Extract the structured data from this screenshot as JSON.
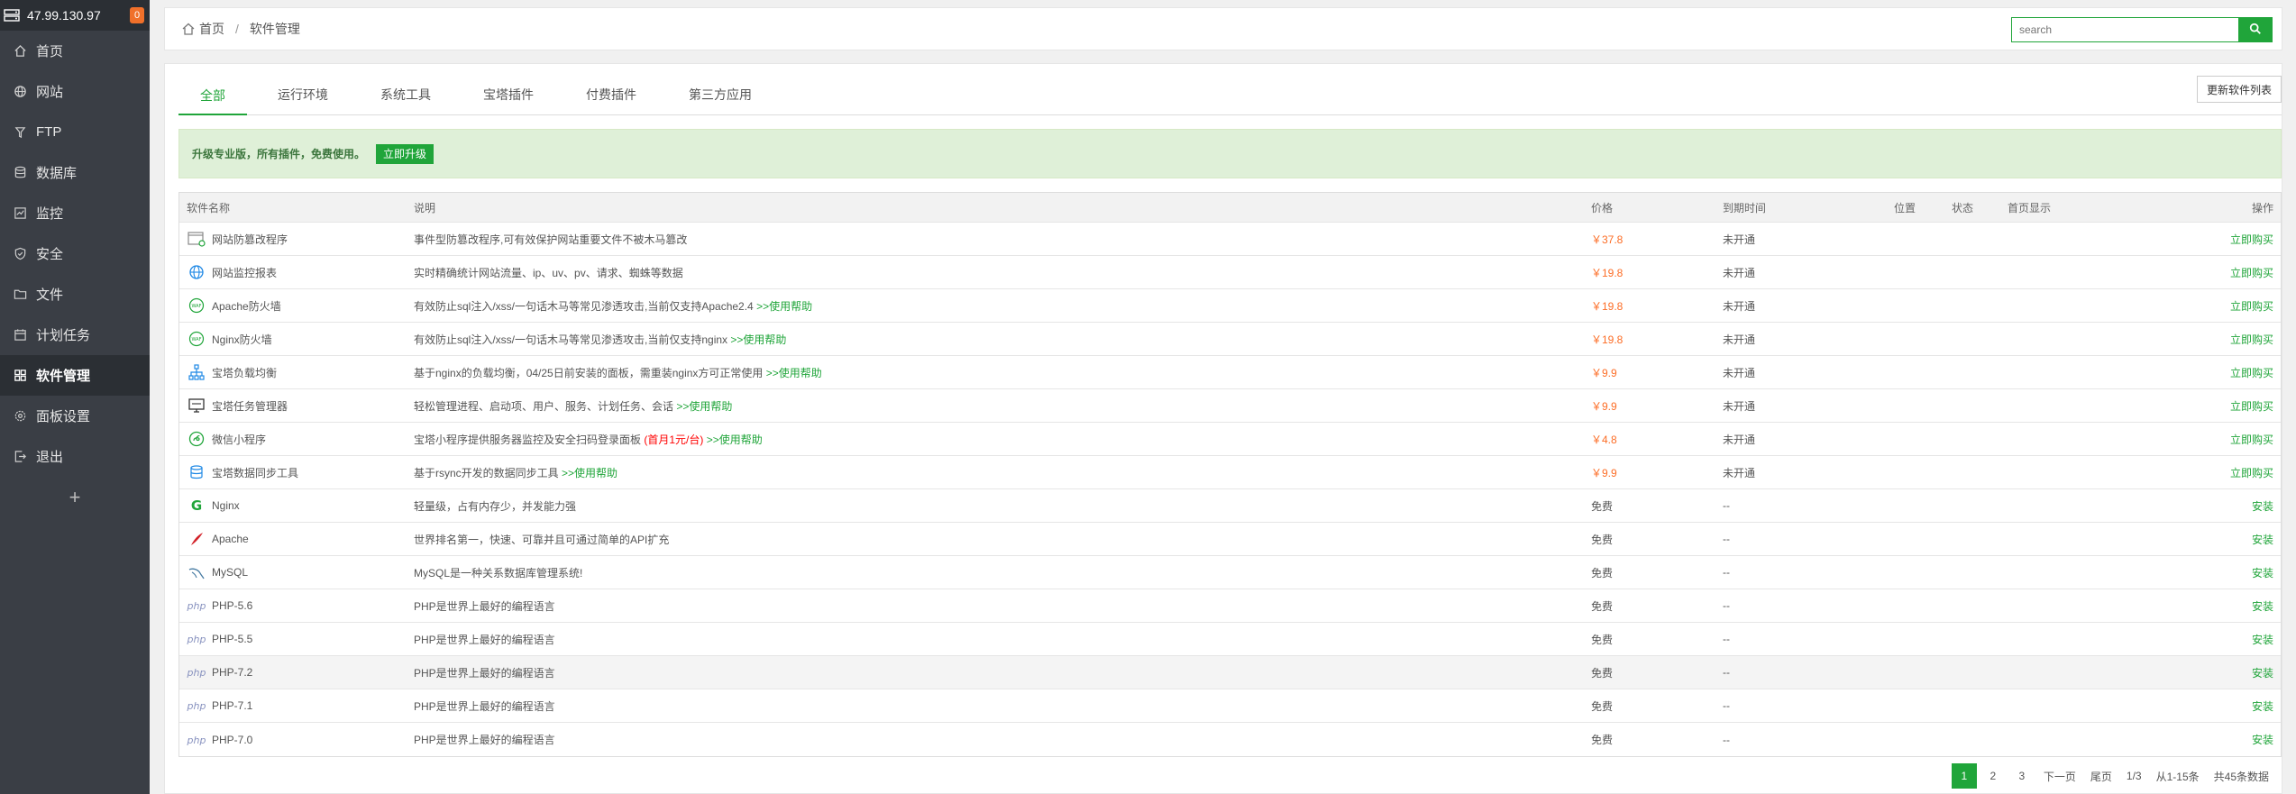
{
  "sidebar": {
    "ip": "47.99.130.97",
    "badge": "0",
    "items": [
      {
        "label": "首页",
        "icon": "home-icon"
      },
      {
        "label": "网站",
        "icon": "globe-icon"
      },
      {
        "label": "FTP",
        "icon": "ftp-icon"
      },
      {
        "label": "数据库",
        "icon": "database-icon"
      },
      {
        "label": "监控",
        "icon": "monitor-icon"
      },
      {
        "label": "安全",
        "icon": "shield-icon"
      },
      {
        "label": "文件",
        "icon": "folder-icon"
      },
      {
        "label": "计划任务",
        "icon": "calendar-icon"
      },
      {
        "label": "软件管理",
        "icon": "grid-icon"
      },
      {
        "label": "面板设置",
        "icon": "gear-icon"
      },
      {
        "label": "退出",
        "icon": "logout-icon"
      }
    ],
    "add_label": "+"
  },
  "breadcrumb": {
    "home": "首页",
    "sep": "/",
    "current": "软件管理"
  },
  "search": {
    "placeholder": "search"
  },
  "tabs": [
    "全部",
    "运行环境",
    "系统工具",
    "宝塔插件",
    "付费插件",
    "第三方应用"
  ],
  "update_button": "更新软件列表",
  "alert": {
    "text": "升级专业版，所有插件，免费使用。",
    "button": "立即升级"
  },
  "table": {
    "headers": {
      "name": "软件名称",
      "desc": "说明",
      "price": "价格",
      "expire": "到期时间",
      "location": "位置",
      "status": "状态",
      "home": "首页显示",
      "op": "操作"
    },
    "rows": [
      {
        "name": "网站防篡改程序",
        "icon": "tamper-icon",
        "desc": "事件型防篡改程序,可有效保护网站重要文件不被木马篡改",
        "help": "",
        "price": "￥37.8",
        "expire": "未开通",
        "op": "立即购买"
      },
      {
        "name": "网站监控报表",
        "icon": "report-icon",
        "desc": "实时精确统计网站流量、ip、uv、pv、请求、蜘蛛等数据",
        "help": "",
        "price": "￥19.8",
        "expire": "未开通",
        "op": "立即购买"
      },
      {
        "name": "Apache防火墙",
        "icon": "waf-icon",
        "desc": "有效防止sql注入/xss/一句话木马等常见渗透攻击,当前仅支持Apache2.4 ",
        "help": ">>使用帮助",
        "price": "￥19.8",
        "expire": "未开通",
        "op": "立即购买"
      },
      {
        "name": "Nginx防火墙",
        "icon": "waf-icon",
        "desc": "有效防止sql注入/xss/一句话木马等常见渗透攻击,当前仅支持nginx ",
        "help": ">>使用帮助",
        "price": "￥19.8",
        "expire": "未开通",
        "op": "立即购买"
      },
      {
        "name": "宝塔负载均衡",
        "icon": "loadbalance-icon",
        "desc": "基于nginx的负载均衡，04/25日前安装的面板，需重装nginx方可正常使用 ",
        "help": ">>使用帮助",
        "price": "￥9.9",
        "expire": "未开通",
        "op": "立即购买"
      },
      {
        "name": "宝塔任务管理器",
        "icon": "taskmgr-icon",
        "desc": "轻松管理进程、启动项、用户、服务、计划任务、会话 ",
        "help": ">>使用帮助",
        "price": "￥9.9",
        "expire": "未开通",
        "op": "立即购买"
      },
      {
        "name": "微信小程序",
        "icon": "wechat-icon",
        "desc": "宝塔小程序提供服务器监控及安全扫码登录面板 ",
        "red": "(首月1元/台)",
        "help": " >>使用帮助",
        "price": "￥4.8",
        "expire": "未开通",
        "op": "立即购买"
      },
      {
        "name": "宝塔数据同步工具",
        "icon": "sync-icon",
        "desc": "基于rsync开发的数据同步工具 ",
        "help": ">>使用帮助",
        "price": "￥9.9",
        "expire": "未开通",
        "op": "立即购买"
      },
      {
        "name": "Nginx",
        "icon": "nginx-icon",
        "desc": "轻量级，占有内存少，并发能力强",
        "help": "",
        "price": "免费",
        "expire": "--",
        "op": "安装"
      },
      {
        "name": "Apache",
        "icon": "apache-icon",
        "desc": "世界排名第一，快速、可靠并且可通过简单的API扩充",
        "help": "",
        "price": "免费",
        "expire": "--",
        "op": "安装"
      },
      {
        "name": "MySQL",
        "icon": "mysql-icon",
        "desc": "MySQL是一种关系数据库管理系统!",
        "help": "",
        "price": "免费",
        "expire": "--",
        "op": "安装"
      },
      {
        "name": "PHP-5.6",
        "icon": "php-icon",
        "desc": "PHP是世界上最好的编程语言",
        "help": "",
        "price": "免费",
        "expire": "--",
        "op": "安装"
      },
      {
        "name": "PHP-5.5",
        "icon": "php-icon",
        "desc": "PHP是世界上最好的编程语言",
        "help": "",
        "price": "免费",
        "expire": "--",
        "op": "安装"
      },
      {
        "name": "PHP-7.2",
        "icon": "php-icon",
        "desc": "PHP是世界上最好的编程语言",
        "help": "",
        "price": "免费",
        "expire": "--",
        "op": "安装"
      },
      {
        "name": "PHP-7.1",
        "icon": "php-icon",
        "desc": "PHP是世界上最好的编程语言",
        "help": "",
        "price": "免费",
        "expire": "--",
        "op": "安装"
      },
      {
        "name": "PHP-7.0",
        "icon": "php-icon",
        "desc": "PHP是世界上最好的编程语言",
        "help": "",
        "price": "免费",
        "expire": "--",
        "op": "安装"
      }
    ]
  },
  "pagination": {
    "pages": [
      "1",
      "2",
      "3"
    ],
    "next": "下一页",
    "last": "尾页",
    "page_info": "1/3",
    "range": "从1-15条",
    "total": "共45条数据"
  },
  "colors": {
    "accent": "#20a53a",
    "price": "#fc6d26",
    "sidebar": "#3a3e45",
    "badge": "#f0702a"
  }
}
